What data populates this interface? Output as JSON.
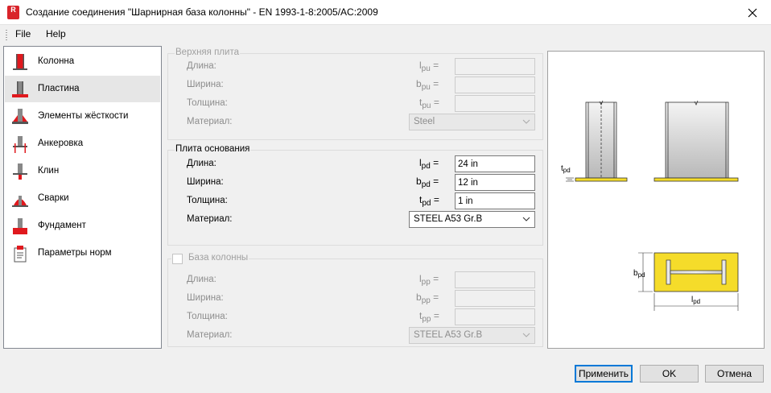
{
  "window": {
    "title": "Создание соединения \"Шарнирная база колонны\" - EN 1993-1-8:2005/AC:2009",
    "icon_letter": "R"
  },
  "menu": {
    "file": "File",
    "help": "Help"
  },
  "nav": {
    "items": [
      {
        "label": "Колонна",
        "icon": "column-icon"
      },
      {
        "label": "Пластина",
        "icon": "plate-icon",
        "selected": true
      },
      {
        "label": "Элементы жёсткости",
        "icon": "stiffeners-icon"
      },
      {
        "label": "Анкеровка",
        "icon": "anchorage-icon"
      },
      {
        "label": "Клин",
        "icon": "wedge-icon"
      },
      {
        "label": "Сварки",
        "icon": "welds-icon"
      },
      {
        "label": "Фундамент",
        "icon": "foundation-icon"
      },
      {
        "label": "Параметры норм",
        "icon": "code-parameters-icon"
      }
    ]
  },
  "top_plate": {
    "title": "Верхняя плита",
    "length_label": "Длина:",
    "length_sym": "l",
    "length_sub": "pu",
    "length_value": "",
    "width_label": "Ширина:",
    "width_sym": "b",
    "width_sub": "pu",
    "width_value": "",
    "thickness_label": "Толщина:",
    "thickness_sym": "t",
    "thickness_sub": "pu",
    "thickness_value": "",
    "material_label": "Материал:",
    "material_value": "Steel"
  },
  "base_plate": {
    "title": "Плита основания",
    "length_label": "Длина:",
    "length_sym": "l",
    "length_sub": "pd",
    "length_value": "24 in",
    "width_label": "Ширина:",
    "width_sym": "b",
    "width_sub": "pd",
    "width_value": "12 in",
    "thickness_label": "Толщина:",
    "thickness_sym": "t",
    "thickness_sub": "pd",
    "thickness_value": "1 in",
    "material_label": "Материал:",
    "material_value": "STEEL A53 Gr.B"
  },
  "column_base": {
    "title": "База колонны",
    "checked": false,
    "length_label": "Длина:",
    "length_sym": "l",
    "length_sub": "pp",
    "length_value": "",
    "width_label": "Ширина:",
    "width_sym": "b",
    "width_sub": "pp",
    "width_value": "",
    "thickness_label": "Толщина:",
    "thickness_sym": "t",
    "thickness_sub": "pp",
    "thickness_value": "",
    "material_label": "Материал:",
    "material_value": "STEEL A53 Gr.B"
  },
  "eq": "=",
  "preview": {
    "t_label": "t",
    "t_sub": "pd",
    "b_label": "b",
    "b_sub": "pd",
    "l_label": "l",
    "l_sub": "pd"
  },
  "buttons": {
    "apply": "Применить",
    "ok": "OK",
    "cancel": "Отмена"
  },
  "colors": {
    "accent": "#0078d7",
    "plate_yellow": "#f5dc2a",
    "icon_red": "#e0191e"
  }
}
